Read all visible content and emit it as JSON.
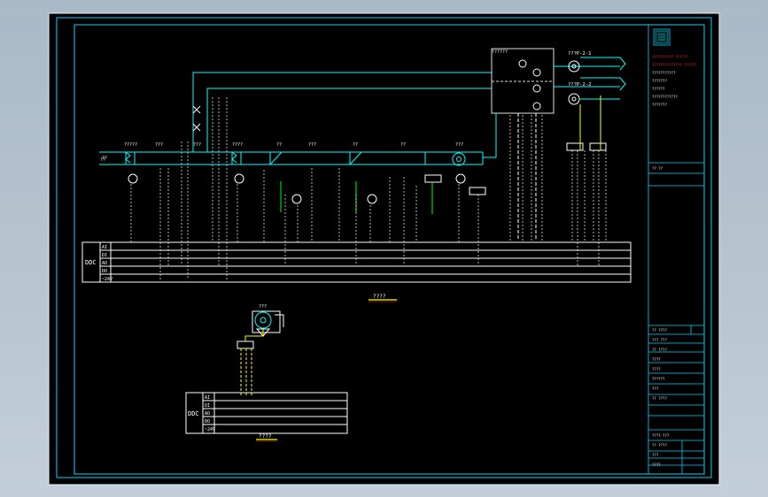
{
  "colors": {
    "background": "#000000",
    "frame": "#00ffff",
    "line": "#ffffff",
    "accent_green": "#00ff00",
    "accent_yellow": "#ffff00",
    "accent_red": "#ff3030",
    "text": "#ffffff",
    "viewport": "#b3c2cf"
  },
  "ddc_panel_main": {
    "label": "DDC",
    "rows": [
      "AI",
      "DI",
      "AO",
      "DO",
      "~24V"
    ]
  },
  "ddc_panel_small": {
    "label": "DDC",
    "rows": [
      "AI",
      "DI",
      "AO",
      "DO",
      "~24V"
    ]
  },
  "captions": {
    "main_diagram": "????",
    "small_diagram": "????",
    "fan_small": "???",
    "outdoor_air": "??"
  },
  "branch_labels": [
    "???P-2-1",
    "???P-2-2"
  ],
  "component_labels": [
    "?????",
    "???",
    "???",
    "????",
    "??",
    "???",
    "??",
    "??",
    "???",
    "??????",
    "??"
  ],
  "title_block": {
    "header_lines": [
      "?????????? ??????",
      "?????????????? ??????",
      "???????????",
      "???????",
      "??????",
      "????????????",
      "???????"
    ],
    "revision_label": "?? ??",
    "table_rows": [
      "?? ????",
      "??? ???",
      "?? ????",
      "????",
      "????",
      "??????",
      "???",
      "?? ????"
    ],
    "bottom_labels": [
      "????-???",
      "?? ????",
      "???",
      "????"
    ]
  }
}
